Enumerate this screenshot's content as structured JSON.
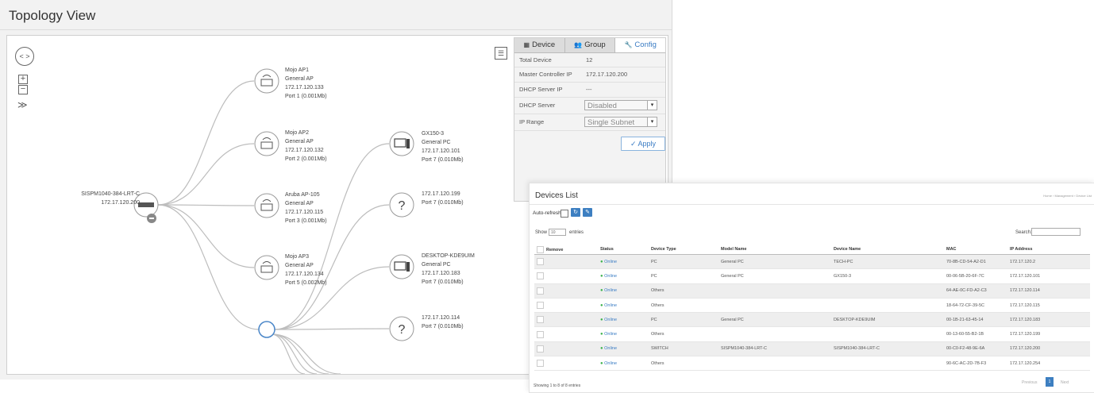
{
  "topology": {
    "title": "Topology View",
    "root": {
      "name": "SISPM1040-384-LRT-C",
      "ip": "172.17.120.200"
    },
    "ap_nodes": [
      {
        "name": "Mojo AP1",
        "type": "General AP",
        "ip": "172.17.120.133",
        "port": "Port 1 (0.001Mb)"
      },
      {
        "name": "Mojo AP2",
        "type": "General AP",
        "ip": "172.17.120.132",
        "port": "Port 2 (0.001Mb)"
      },
      {
        "name": "Aruba AP-105",
        "type": "General AP",
        "ip": "172.17.120.115",
        "port": "Port 3 (0.001Mb)"
      },
      {
        "name": "Mojo AP3",
        "type": "General AP",
        "ip": "172.17.120.134",
        "port": "Port 5 (0.002Mb)"
      }
    ],
    "client_nodes": [
      {
        "name": "GX150-3",
        "type": "General PC",
        "ip": "172.17.120.101",
        "port": "Port 7 (0.010Mb)"
      },
      {
        "ip": "172.17.120.199",
        "port": "Port 7 (0.010Mb)"
      },
      {
        "name": "DESKTOP-KDE9UIM",
        "type": "General PC",
        "ip": "172.17.120.183",
        "port": "Port 7 (0.010Mb)"
      },
      {
        "ip": "172.17.120.114",
        "port": "Port 7 (0.010Mb)"
      }
    ],
    "unknown_glyph": "?",
    "controls": {
      "pan": "< >",
      "zoom_in": "+",
      "zoom_out": "−",
      "expand": "≫"
    }
  },
  "config_panel": {
    "tabs": [
      {
        "label": "Device",
        "icon": "grid-icon"
      },
      {
        "label": "Group",
        "icon": "users-icon"
      },
      {
        "label": "Config",
        "icon": "wrench-icon",
        "active": true
      }
    ],
    "rows": [
      {
        "label": "Total Device",
        "value": "12"
      },
      {
        "label": "Master Controller IP",
        "value": "172.17.120.200"
      },
      {
        "label": "DHCP Server IP",
        "value": "---"
      }
    ],
    "dhcp_server": {
      "label": "DHCP Server",
      "value": "Disabled"
    },
    "ip_range": {
      "label": "IP Range",
      "value": "Single Subnet"
    },
    "apply_label": "Apply",
    "apply_icon": "✓"
  },
  "devices_list": {
    "title": "Devices List",
    "breadcrumb": "Home › Management › Device List",
    "auto_refresh_label": "Auto-refresh",
    "show_label": "Show",
    "entries_value": "10",
    "entries_label": "entries",
    "search_label": "Search:",
    "columns": [
      "Remove",
      "Status",
      "Device Type",
      "Model Name",
      "Device Name",
      "MAC",
      "IP Address"
    ],
    "rows": [
      {
        "status": "Online",
        "type": "PC",
        "model": "General PC",
        "device": "TECH-PC",
        "mac": "70-8B-CD-54-A2-D1",
        "ip": "172.17.120.2"
      },
      {
        "status": "Online",
        "type": "PC",
        "model": "General PC",
        "device": "GX150-3",
        "mac": "00-06-5B-20-6F-7C",
        "ip": "172.17.120.101"
      },
      {
        "status": "Online",
        "type": "Others",
        "model": "",
        "device": "",
        "mac": "64-AE-0C-FD-A2-C3",
        "ip": "172.17.120.114"
      },
      {
        "status": "Online",
        "type": "Others",
        "model": "",
        "device": "",
        "mac": "18-64-72-CF-39-5C",
        "ip": "172.17.120.115"
      },
      {
        "status": "Online",
        "type": "PC",
        "model": "General PC",
        "device": "DESKTOP-KDE9UIM",
        "mac": "00-1B-21-63-45-14",
        "ip": "172.17.120.183"
      },
      {
        "status": "Online",
        "type": "Others",
        "model": "",
        "device": "",
        "mac": "00-13-60-55-B2-1B",
        "ip": "172.17.120.199"
      },
      {
        "status": "Online",
        "type": "SWITCH",
        "model": "SISPM1040-384-LRT-C",
        "device": "SISPM1040-384-LRT-C",
        "mac": "00-C0-F2-48-9E-6A",
        "ip": "172.17.120.200"
      },
      {
        "status": "Online",
        "type": "Others",
        "model": "",
        "device": "",
        "mac": "90-6C-AC-2D-7B-F3",
        "ip": "172.17.120.254"
      }
    ],
    "footer": "Showing 1 to 8 of 8 entries",
    "pagination": {
      "prev": "Previous",
      "current": "1",
      "next": "Next"
    }
  },
  "colors": {
    "accent": "#3d7fc1",
    "online": "#3fb34f",
    "link_line": "#bdbdbd",
    "hub_ring": "#4a86c8"
  }
}
